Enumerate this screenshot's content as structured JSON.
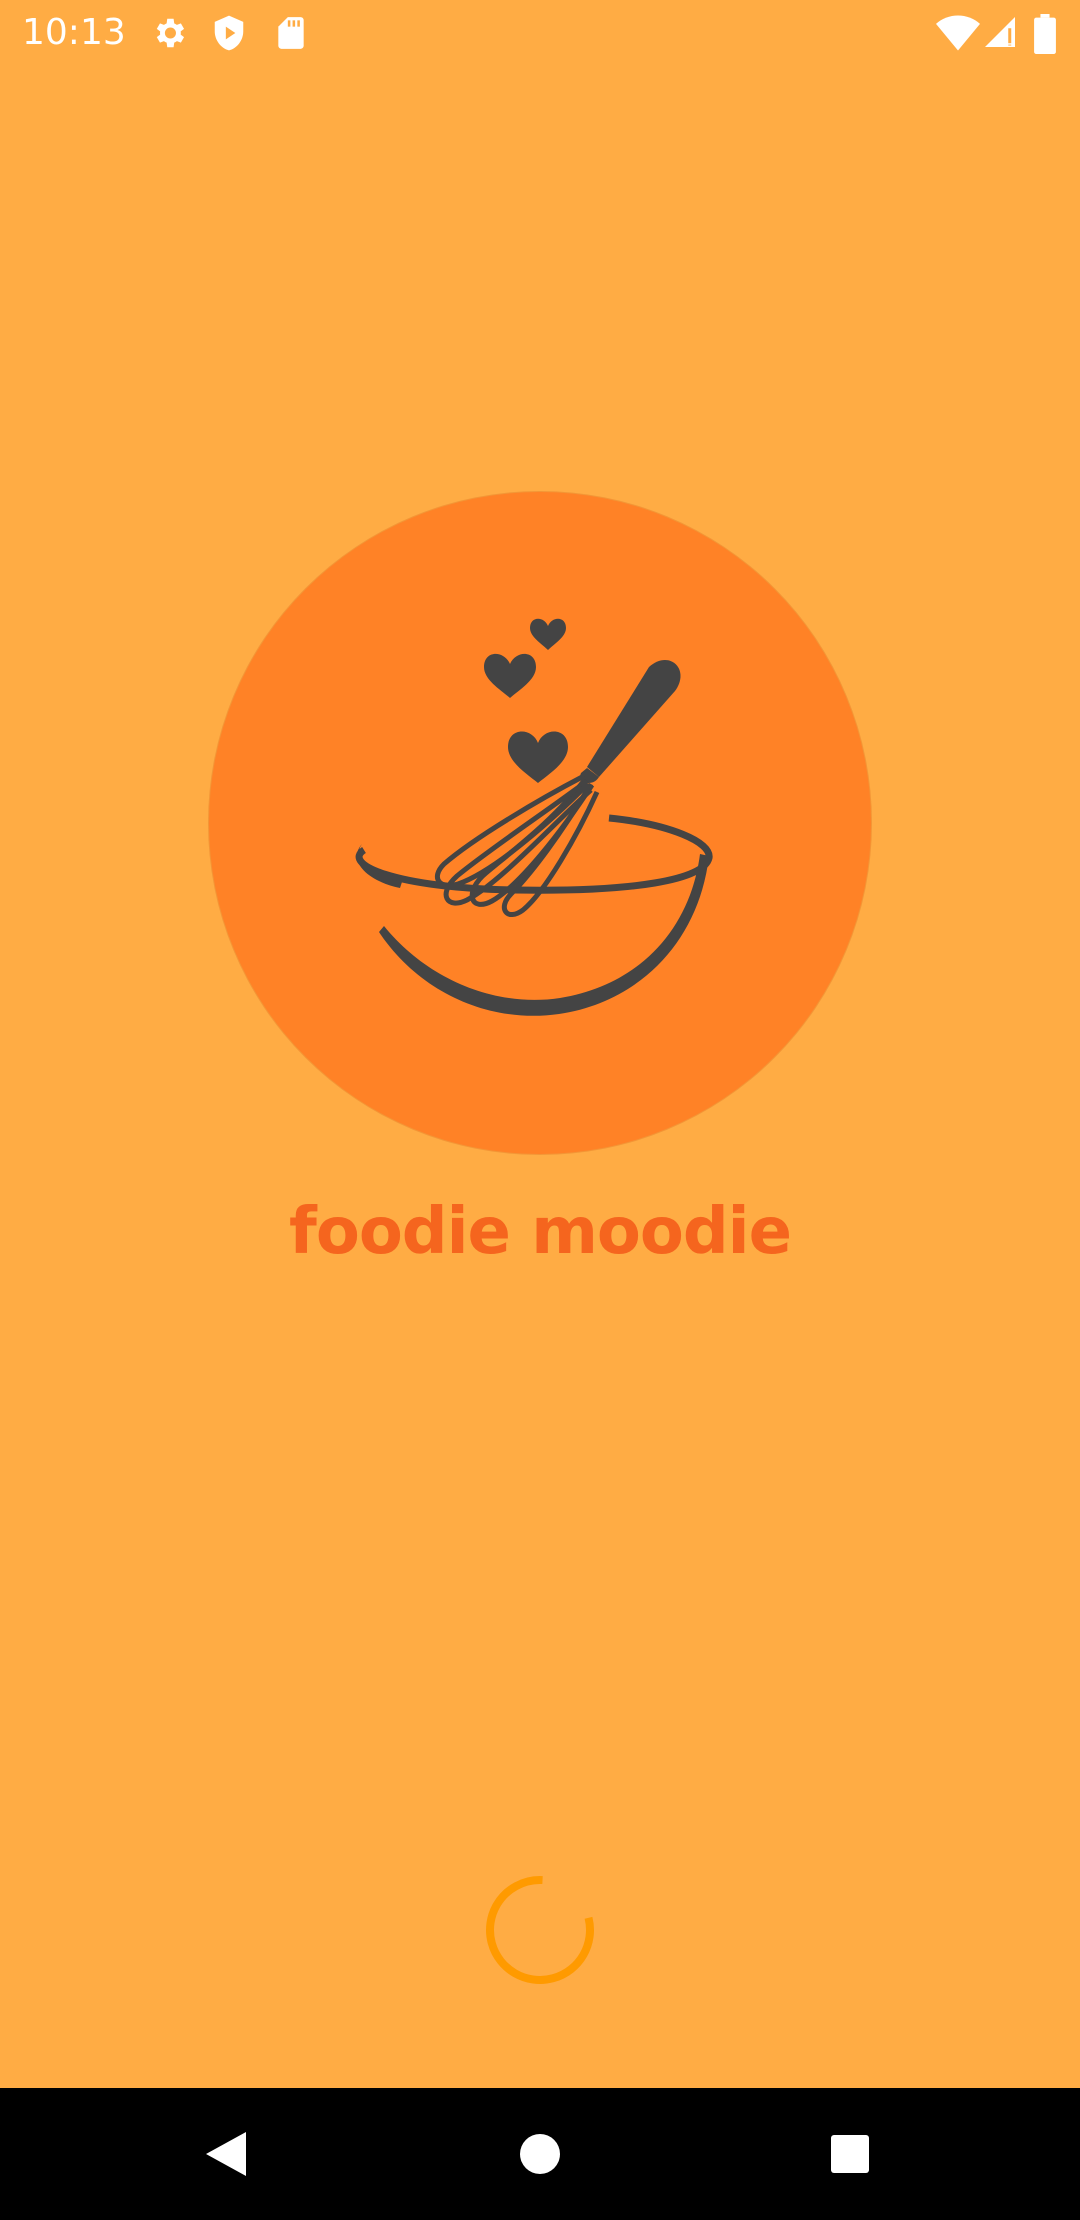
{
  "status_bar": {
    "time": "10:13",
    "left_icons": [
      "settings-icon",
      "shield-icon",
      "sd-card-icon"
    ],
    "right_icons": [
      "wifi-icon",
      "cellular-signal-icon",
      "battery-icon"
    ]
  },
  "splash": {
    "app_name": "foodie moodie",
    "logo_icon": "whisk-bowl-hearts-logo",
    "loading_icon": "loading-spinner"
  },
  "nav_bar": {
    "buttons": [
      "back-icon",
      "home-icon",
      "recents-icon"
    ]
  },
  "colors": {
    "background": "#FFAC44",
    "logo_circle": "#FF8226",
    "logo_ink": "#444444",
    "app_name": "#F5651E",
    "spinner": "#FF9A00",
    "nav_bar": "#000000",
    "status_icons": "#FFFFFF"
  }
}
